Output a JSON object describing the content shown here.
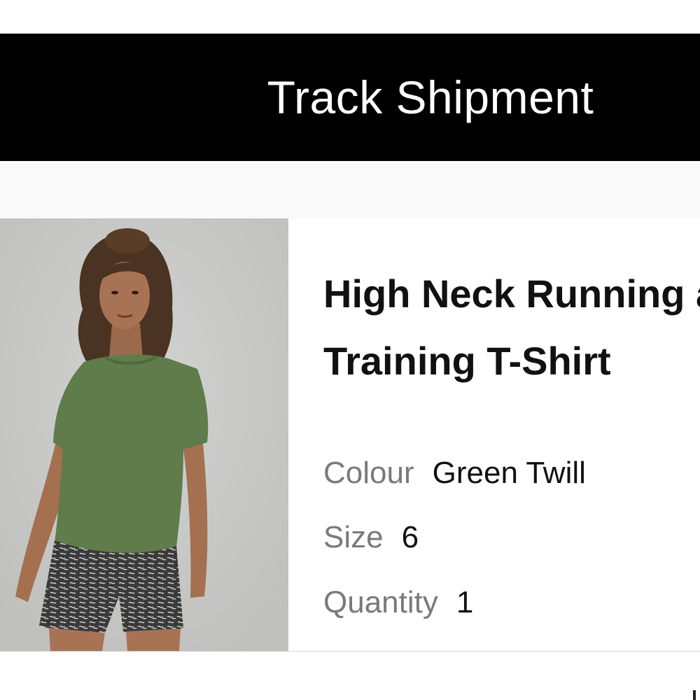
{
  "track_button": {
    "label": "Track Shipment"
  },
  "item": {
    "image_alt": "Model wearing green t-shirt",
    "name_lines": [
      "High Neck Running and",
      "Training T-Shirt"
    ],
    "attributes": {
      "colour": {
        "label": "Colour",
        "value": "Green Twill"
      },
      "size": {
        "label": "Size",
        "value": "6"
      },
      "quantity": {
        "label": "Quantity",
        "value": "1"
      }
    }
  },
  "colors": {
    "button_bg": "#000000",
    "button_text": "#ffffff",
    "label_text": "#7a7a7a",
    "value_text": "#111111",
    "shirt": "#5f7c4a",
    "photo_bg": "#c9cac8"
  }
}
